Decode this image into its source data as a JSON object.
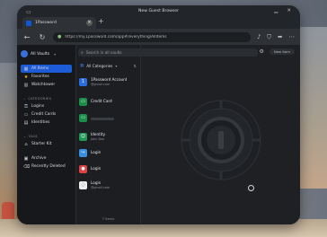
{
  "window": {
    "title": "New Guest Browser"
  },
  "tab": {
    "label": "1Password"
  },
  "navbar": {
    "url": "https://my.1password.com/app#/everything/AllItems"
  },
  "sidebar": {
    "vault_label": "All Vaults",
    "items": [
      {
        "label": "All Items",
        "icon": "grid-icon"
      },
      {
        "label": "Favorites",
        "icon": "star-icon"
      },
      {
        "label": "Watchtower",
        "icon": "watchtower-icon"
      }
    ],
    "categories_heading": "CATEGORIES",
    "categories": [
      {
        "label": "Logins",
        "icon": "key-icon"
      },
      {
        "label": "Credit Cards",
        "icon": "card-icon"
      },
      {
        "label": "Identities",
        "icon": "identity-icon"
      }
    ],
    "tags_heading": "TAGS",
    "tags": [
      {
        "label": "Starter Kit",
        "icon": "tag-icon"
      }
    ],
    "bottom": [
      {
        "label": "Archive",
        "icon": "archive-icon"
      },
      {
        "label": "Recently Deleted",
        "icon": "trash-icon"
      }
    ]
  },
  "list": {
    "search_placeholder": "Search in all vaults",
    "category_filter": "All Categories",
    "rows": [
      {
        "title": "1Password Account",
        "subtitle": "@gmail.com",
        "color": "#2a6de0",
        "glyph": "1"
      },
      {
        "title": "Credit Card",
        "subtitle": "",
        "color": "#1b8f4a",
        "glyph": "▭"
      },
      {
        "title": "",
        "subtitle": "",
        "color": "#1b8f4a",
        "glyph": "▭"
      },
      {
        "title": "Identity",
        "subtitle": "John Doe",
        "color": "#1f9a56",
        "glyph": "☺"
      },
      {
        "title": "Login",
        "subtitle": "",
        "color": "#3a8fe0",
        "glyph": "↪"
      },
      {
        "title": "Login",
        "subtitle": "",
        "color": "#e04242",
        "glyph": "●"
      },
      {
        "title": "Login",
        "subtitle": "@gmail.com",
        "color": "#eeeeee",
        "glyph": "◌"
      }
    ],
    "count": "7 items"
  },
  "detail": {
    "new_item_label": "New Item"
  }
}
